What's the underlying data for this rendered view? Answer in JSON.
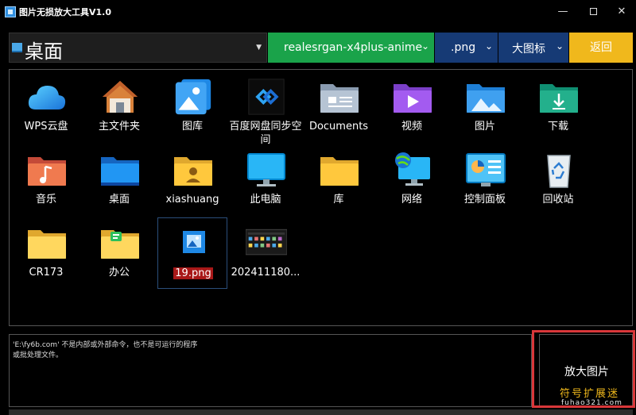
{
  "window": {
    "title": "图片无损放大工具V1.0",
    "controls": {
      "minimize": "—",
      "close": "✕"
    }
  },
  "toolbar": {
    "path": "桌面",
    "model": "realesrgan-x4plus-anime",
    "format": ".png",
    "view": "大图标",
    "back_label": "返回"
  },
  "files": [
    {
      "label": "WPS云盘",
      "icon": "wps-cloud-icon"
    },
    {
      "label": "主文件夹",
      "icon": "home-icon"
    },
    {
      "label": "图库",
      "icon": "gallery-icon"
    },
    {
      "label": "百度网盘同步空间",
      "icon": "baidu-netdisk-icon"
    },
    {
      "label": "Documents",
      "icon": "documents-folder-icon"
    },
    {
      "label": "视频",
      "icon": "videos-folder-icon"
    },
    {
      "label": "图片",
      "icon": "pictures-folder-icon"
    },
    {
      "label": "下载",
      "icon": "downloads-folder-icon"
    },
    {
      "label": "音乐",
      "icon": "music-folder-icon"
    },
    {
      "label": "桌面",
      "icon": "desktop-folder-icon"
    },
    {
      "label": "xiashuang",
      "icon": "user-folder-icon"
    },
    {
      "label": "此电脑",
      "icon": "this-pc-icon"
    },
    {
      "label": "库",
      "icon": "library-folder-icon"
    },
    {
      "label": "网络",
      "icon": "network-icon"
    },
    {
      "label": "控制面板",
      "icon": "control-panel-icon"
    },
    {
      "label": "回收站",
      "icon": "recycle-bin-icon"
    },
    {
      "label": "CR173",
      "icon": "folder-icon"
    },
    {
      "label": "办公",
      "icon": "office-folder-icon"
    },
    {
      "label": "19.png",
      "icon": "png-file-icon"
    },
    {
      "label": "202411180...",
      "icon": "screenshot-thumbnail-icon"
    }
  ],
  "console": {
    "lines": [
      "'E:\\fy6b.com' 不是内部或外部命令，也不是可运行的程序",
      "或批处理文件。"
    ]
  },
  "actions": {
    "enlarge_label": "放大图片"
  },
  "watermark": {
    "brand": "符号扩展迷",
    "url": "fuhao321.com"
  },
  "colors": {
    "model_bg": "#1aa34a",
    "dropdown_bg": "#163a75",
    "back_bg": "#f0b81c",
    "selection_bg": "#a81818",
    "highlight_border": "#d9373a"
  }
}
